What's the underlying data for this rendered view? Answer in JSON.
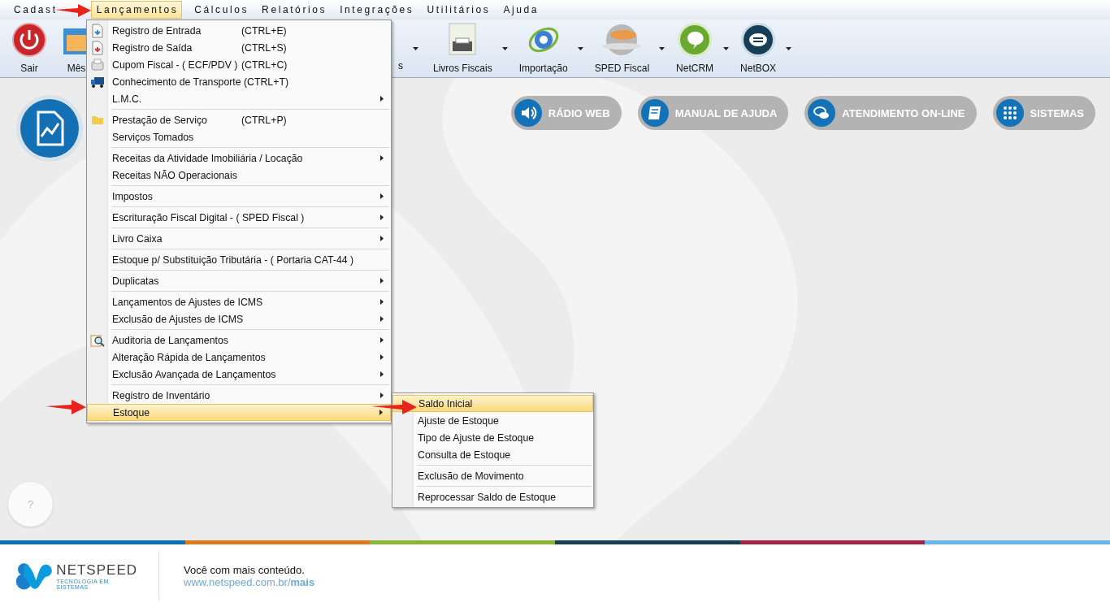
{
  "menu_bar": [
    {
      "label": "Cadast",
      "selected": false
    },
    {
      "label": "Lançamentos",
      "selected": true
    },
    {
      "label": "Cálculos",
      "selected": false
    },
    {
      "label": "Relatórios",
      "selected": false
    },
    {
      "label": "Integrações",
      "selected": false
    },
    {
      "label": "Utilitários",
      "selected": false
    },
    {
      "label": "Ajuda",
      "selected": false
    }
  ],
  "toolbar": [
    {
      "label": "Sair",
      "kind": "power",
      "dropdown": false
    },
    {
      "label": "Mês",
      "kind": "calendar",
      "dropdown": false
    },
    {
      "label": "s",
      "kind": "fragment",
      "dropdown": true
    },
    {
      "label": "Livros Fiscais",
      "kind": "printer",
      "dropdown": true
    },
    {
      "label": "Importação",
      "kind": "nfe",
      "dropdown": true
    },
    {
      "label": "SPED Fiscal",
      "kind": "sped",
      "dropdown": true
    },
    {
      "label": "NetCRM",
      "kind": "crm",
      "dropdown": true
    },
    {
      "label": "NetBOX",
      "kind": "box",
      "dropdown": true
    }
  ],
  "web_buttons": [
    {
      "label": "RÁDIO WEB",
      "kind": "speaker"
    },
    {
      "label": "MANUAL DE AJUDA",
      "kind": "book"
    },
    {
      "label": "ATENDIMENTO ON-LINE",
      "kind": "chat"
    },
    {
      "label": "SISTEMAS",
      "kind": "grid"
    }
  ],
  "help_button": {
    "label": "?"
  },
  "dropdown": {
    "groups": [
      [
        {
          "label": "Registro de Entrada",
          "shortcut": "(CTRL+E)",
          "submenu": false,
          "selected": false
        },
        {
          "label": "Registro de Saída",
          "shortcut": "(CTRL+S)",
          "submenu": false,
          "selected": false
        },
        {
          "label": "Cupom Fiscal - ( ECF/PDV )",
          "shortcut": "(CTRL+C)",
          "submenu": false,
          "selected": false
        },
        {
          "label": "Conhecimento de Transporte (CTRL+T)",
          "submenu": false,
          "selected": false
        },
        {
          "label": "L.M.C.",
          "submenu": true,
          "selected": false
        }
      ],
      [
        {
          "label": "Prestação de Serviço",
          "shortcut": "(CTRL+P)",
          "submenu": false,
          "selected": false
        },
        {
          "label": "Serviços Tomados",
          "submenu": false,
          "selected": false
        }
      ],
      [
        {
          "label": "Receitas da Atividade Imobiliária / Locação",
          "submenu": true,
          "selected": false
        },
        {
          "label": "Receitas NÃO Operacionais",
          "submenu": false,
          "selected": false
        }
      ],
      [
        {
          "label": "Impostos",
          "submenu": true,
          "selected": false
        }
      ],
      [
        {
          "label": "Escrituração Fiscal Digital - ( SPED Fiscal )",
          "submenu": true,
          "selected": false
        }
      ],
      [
        {
          "label": "Livro Caixa",
          "submenu": true,
          "selected": false
        }
      ],
      [
        {
          "label": "Estoque p/ Substituição Tributária - ( Portaria CAT-44 )",
          "submenu": false,
          "selected": false
        }
      ],
      [
        {
          "label": "Duplicatas",
          "submenu": true,
          "selected": false
        }
      ],
      [
        {
          "label": "Lançamentos de Ajustes de ICMS",
          "submenu": true,
          "selected": false
        },
        {
          "label": "Exclusão de Ajustes de ICMS",
          "submenu": true,
          "selected": false
        }
      ],
      [
        {
          "label": "Auditoria de Lançamentos",
          "submenu": true,
          "selected": false
        },
        {
          "label": "Alteração Rápida de Lançamentos",
          "submenu": true,
          "selected": false
        },
        {
          "label": "Exclusão Avançada de Lançamentos",
          "submenu": true,
          "selected": false
        }
      ],
      [
        {
          "label": "Registro de Inventário",
          "submenu": true,
          "selected": false
        },
        {
          "label": "Estoque",
          "submenu": true,
          "selected": true
        }
      ]
    ]
  },
  "submenu": {
    "groups": [
      [
        {
          "label": "Saldo Inicial",
          "selected": true
        },
        {
          "label": "Ajuste de Estoque",
          "selected": false
        },
        {
          "label": "Tipo de Ajuste de Estoque",
          "selected": false
        },
        {
          "label": "Consulta de Estoque",
          "selected": false
        }
      ],
      [
        {
          "label": "Exclusão de Movimento",
          "selected": false
        }
      ],
      [
        {
          "label": "Reprocessar Saldo de Estoque",
          "selected": false
        }
      ]
    ]
  },
  "footer": {
    "brand": "NETSPEED",
    "tagline": "TECNOLOGIA EM SISTEMAS",
    "slogan": "Você com mais conteúdo.",
    "link": "www.netspeed.com.br/**mais**"
  }
}
